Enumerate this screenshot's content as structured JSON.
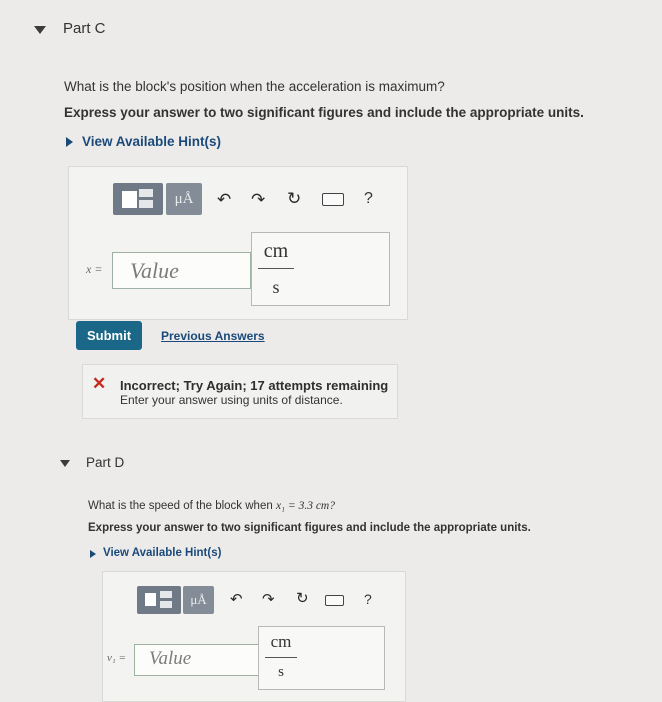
{
  "partC": {
    "title": "Part C",
    "question": "What is the block's position when the acceleration is maximum?",
    "instruction": "Express your answer to two significant figures and include the appropriate units.",
    "hint_link": "View Available Hint(s)",
    "toolbar": {
      "units_symbol": "μÅ",
      "help_label": "?",
      "icons": [
        "templates-icon",
        "units-icon",
        "undo-icon",
        "redo-icon",
        "reset-icon",
        "keyboard-icon",
        "help-icon"
      ]
    },
    "variable_label": "x =",
    "value_placeholder": "Value",
    "unit_numerator": "cm",
    "unit_denominator": "s",
    "submit_label": "Submit",
    "previous_answers": "Previous Answers",
    "feedback": {
      "title": "Incorrect; Try Again; 17 attempts remaining",
      "message": "Enter your answer using units of distance."
    }
  },
  "partD": {
    "title": "Part D",
    "question_pre": "What is the speed of the block when",
    "question_var": "x₁ = 3.3 cm?",
    "instruction": "Express your answer to two significant figures and include the appropriate units.",
    "hint_link": "View Available Hint(s)",
    "toolbar": {
      "units_symbol": "μÅ",
      "help_label": "?"
    },
    "variable_label": "v₁ =",
    "value_placeholder": "Value",
    "unit_numerator": "cm",
    "unit_denominator": "s"
  },
  "colors": {
    "background": "#ecebe9",
    "link": "#1b4a7a",
    "submit": "#1a6788",
    "error": "#c42a1f"
  }
}
